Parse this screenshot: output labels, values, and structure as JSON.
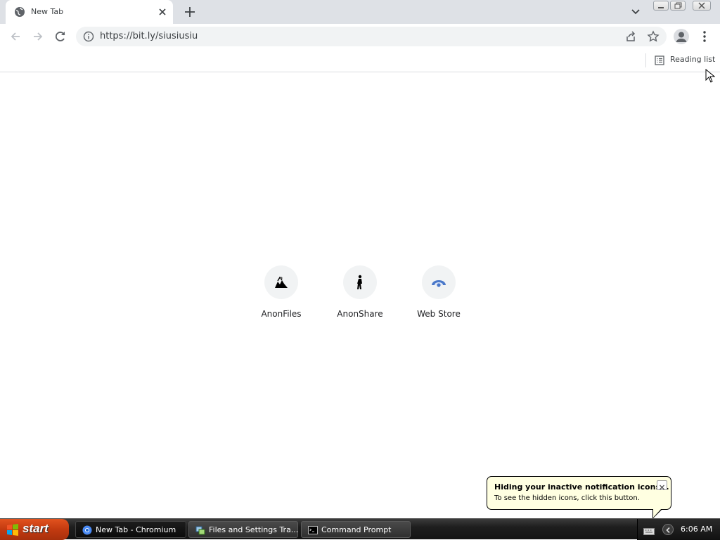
{
  "browser": {
    "tab": {
      "title": "New Tab"
    },
    "omnibox": {
      "url": "https://bit.ly/siusiusiu"
    },
    "bookmarks_bar": {
      "reading_list_label": "Reading list"
    }
  },
  "new_tab_page": {
    "shortcuts": [
      {
        "label": "AnonFiles",
        "icon": "anonfiles-icon"
      },
      {
        "label": "AnonShare",
        "icon": "anonshare-icon"
      },
      {
        "label": "Web Store",
        "icon": "webstore-icon"
      }
    ]
  },
  "notification_balloon": {
    "title": "Hiding your inactive notification icons...",
    "body": "To see the hidden icons, click this button."
  },
  "taskbar": {
    "start_label": "start",
    "tasks": [
      {
        "label": "New Tab - Chromium",
        "icon": "chromium-icon",
        "active": true
      },
      {
        "label": "Files and Settings Tra...",
        "icon": "transfer-wizard-icon",
        "active": false
      },
      {
        "label": "Command Prompt",
        "icon": "cmd-icon",
        "active": false
      }
    ],
    "clock": "6:06 AM"
  },
  "colors": {
    "tabstrip_bg": "#dee1e6",
    "omnibox_bg": "#f1f3f4",
    "balloon_bg": "#ffffe1",
    "start_button": "#c23a10",
    "taskbar_bg": "#1e1e1e"
  }
}
